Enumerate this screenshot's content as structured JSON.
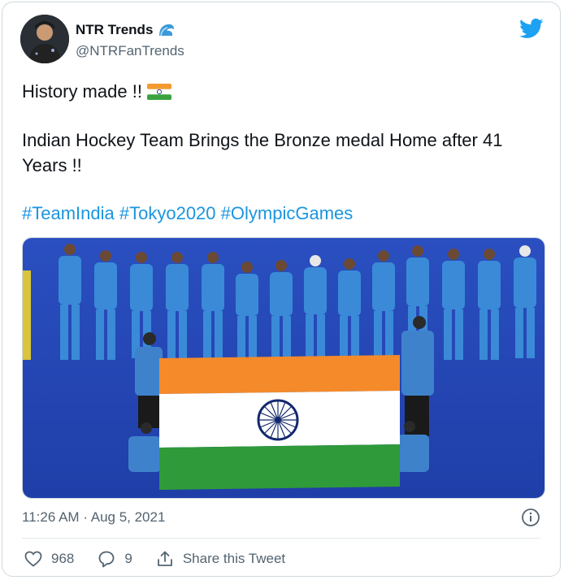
{
  "user": {
    "display_name": "NTR Trends",
    "handle": "@NTRFanTrends",
    "badge_icon": "wave-icon",
    "avatar_icon": "person-avatar"
  },
  "header": {
    "logo_icon": "twitter-bird-icon",
    "brand_color": "#1da1f2"
  },
  "tweet": {
    "line1": "History made !!",
    "line1_emoji": "india-flag-emoji",
    "line2": "Indian Hockey Team Brings the Bronze medal Home after 41 Years !!",
    "hashtags": [
      "#TeamIndia",
      "#Tokyo2020",
      "#OlympicGames"
    ],
    "link_color": "#1b95e0"
  },
  "media": {
    "description_icon": "team-photo-with-flag"
  },
  "meta": {
    "timestamp": "11:26 AM · Aug 5, 2021",
    "info_icon": "info-icon"
  },
  "actions": {
    "like_count": "968",
    "reply_count": "9",
    "share_label": "Share this Tweet"
  }
}
